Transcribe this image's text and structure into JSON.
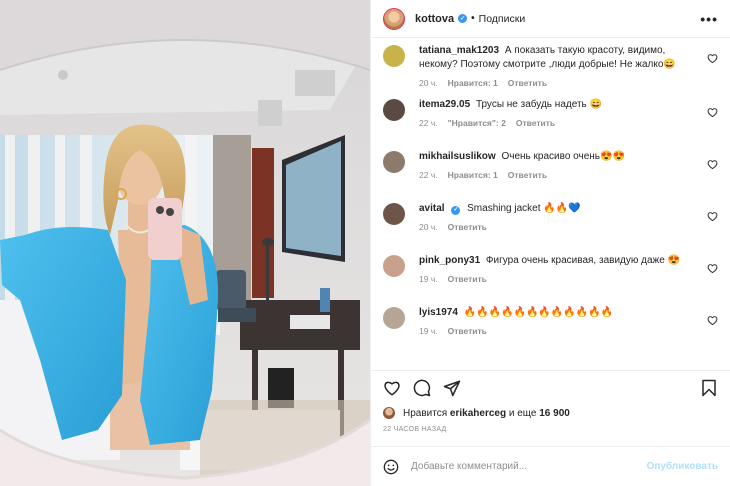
{
  "header": {
    "username": "kottova",
    "verified_mark": "✓",
    "separator": "•",
    "follow_state": "Подписки",
    "more_icon": "•••"
  },
  "comments": [
    {
      "user": "tatiana_mak1203",
      "text": "А показать такую красоту, видимо, некому? Поэтому смотрите ,люди добрые! Не жалко😄",
      "time": "20 ч.",
      "likes": "Нравится: 1",
      "reply": "Ответить",
      "avatar_color": "#c8b24a"
    },
    {
      "user": "itema29.05",
      "text": "Трусы не забудь надеть 😄",
      "time": "22 ч.",
      "likes": "\"Нравится\": 2",
      "reply": "Ответить",
      "avatar_color": "#5a4a44"
    },
    {
      "user": "mikhailsuslikow",
      "text": "Очень красиво очень😍😍",
      "time": "22 ч.",
      "likes": "Нравится: 1",
      "reply": "Ответить",
      "avatar_color": "#8c7a6a"
    },
    {
      "user": "avital",
      "verified": true,
      "text": "Smashing jacket 🔥🔥💙",
      "time": "20 ч.",
      "likes": "",
      "reply": "Ответить",
      "avatar_color": "#6d5647"
    },
    {
      "user": "pink_pony31",
      "text": "Фигура очень красивая, завидую даже 😍",
      "time": "19 ч.",
      "likes": "",
      "reply": "Ответить",
      "avatar_color": "#c9a08c"
    },
    {
      "user": "lyis1974",
      "text": "🔥🔥🔥🔥🔥🔥🔥🔥🔥🔥🔥🔥",
      "time": "19 ч.",
      "likes": "",
      "reply": "Ответить",
      "avatar_color": "#b6a595"
    }
  ],
  "likes": {
    "prefix": "Нравится",
    "user": "erikaherceg",
    "middle": "и еще",
    "count": "16 900"
  },
  "timestamp": "22 ЧАСОВ НАЗАД",
  "add_comment": {
    "placeholder": "Добавьте комментарий...",
    "publish": "Опубликовать"
  },
  "icons": {
    "heart": "heart-icon",
    "comment": "comment-icon",
    "share": "share-icon",
    "bookmark": "bookmark-icon",
    "emoji": "emoji-icon"
  },
  "colors": {
    "verified": "#3897f0",
    "jacket": "#3cb4e6",
    "publish_disabled": "#b2dffc",
    "secondary_text": "#8e8e8e"
  }
}
